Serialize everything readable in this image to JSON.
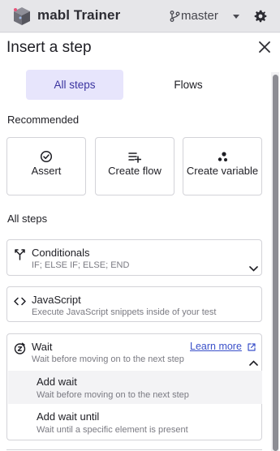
{
  "app": {
    "title": "mabl Trainer",
    "branch": "master"
  },
  "panel": {
    "title": "Insert a step",
    "tabs": [
      {
        "label": "All steps",
        "active": true
      },
      {
        "label": "Flows",
        "active": false
      }
    ],
    "recommended_label": "Recommended",
    "recommended": [
      {
        "label": "Assert",
        "icon": "check-circle-icon"
      },
      {
        "label": "Create flow",
        "icon": "add-list-icon"
      },
      {
        "label": "Create variable",
        "icon": "variable-dots-icon"
      }
    ],
    "all_steps_label": "All steps",
    "steps": [
      {
        "title": "Conditionals",
        "description": "IF; ELSE IF; ELSE; END",
        "icon": "branch-fork-icon",
        "expanded": false
      },
      {
        "title": "JavaScript",
        "description": "Execute JavaScript snippets inside of your test",
        "icon": "code-brackets-icon",
        "expanded": false
      },
      {
        "title": "Wait",
        "description": "Wait before moving on to the next step",
        "icon": "timer-icon",
        "expanded": true,
        "learn_more": "Learn more",
        "items": [
          {
            "title": "Add wait",
            "description": "Wait before moving on to the next step"
          },
          {
            "title": "Add wait until",
            "description": "Wait until a specific element is present"
          }
        ]
      }
    ]
  },
  "colors": {
    "accent": "#3b34a0",
    "tab_active_bg": "#e7e5fc",
    "link": "#3a50c9"
  }
}
